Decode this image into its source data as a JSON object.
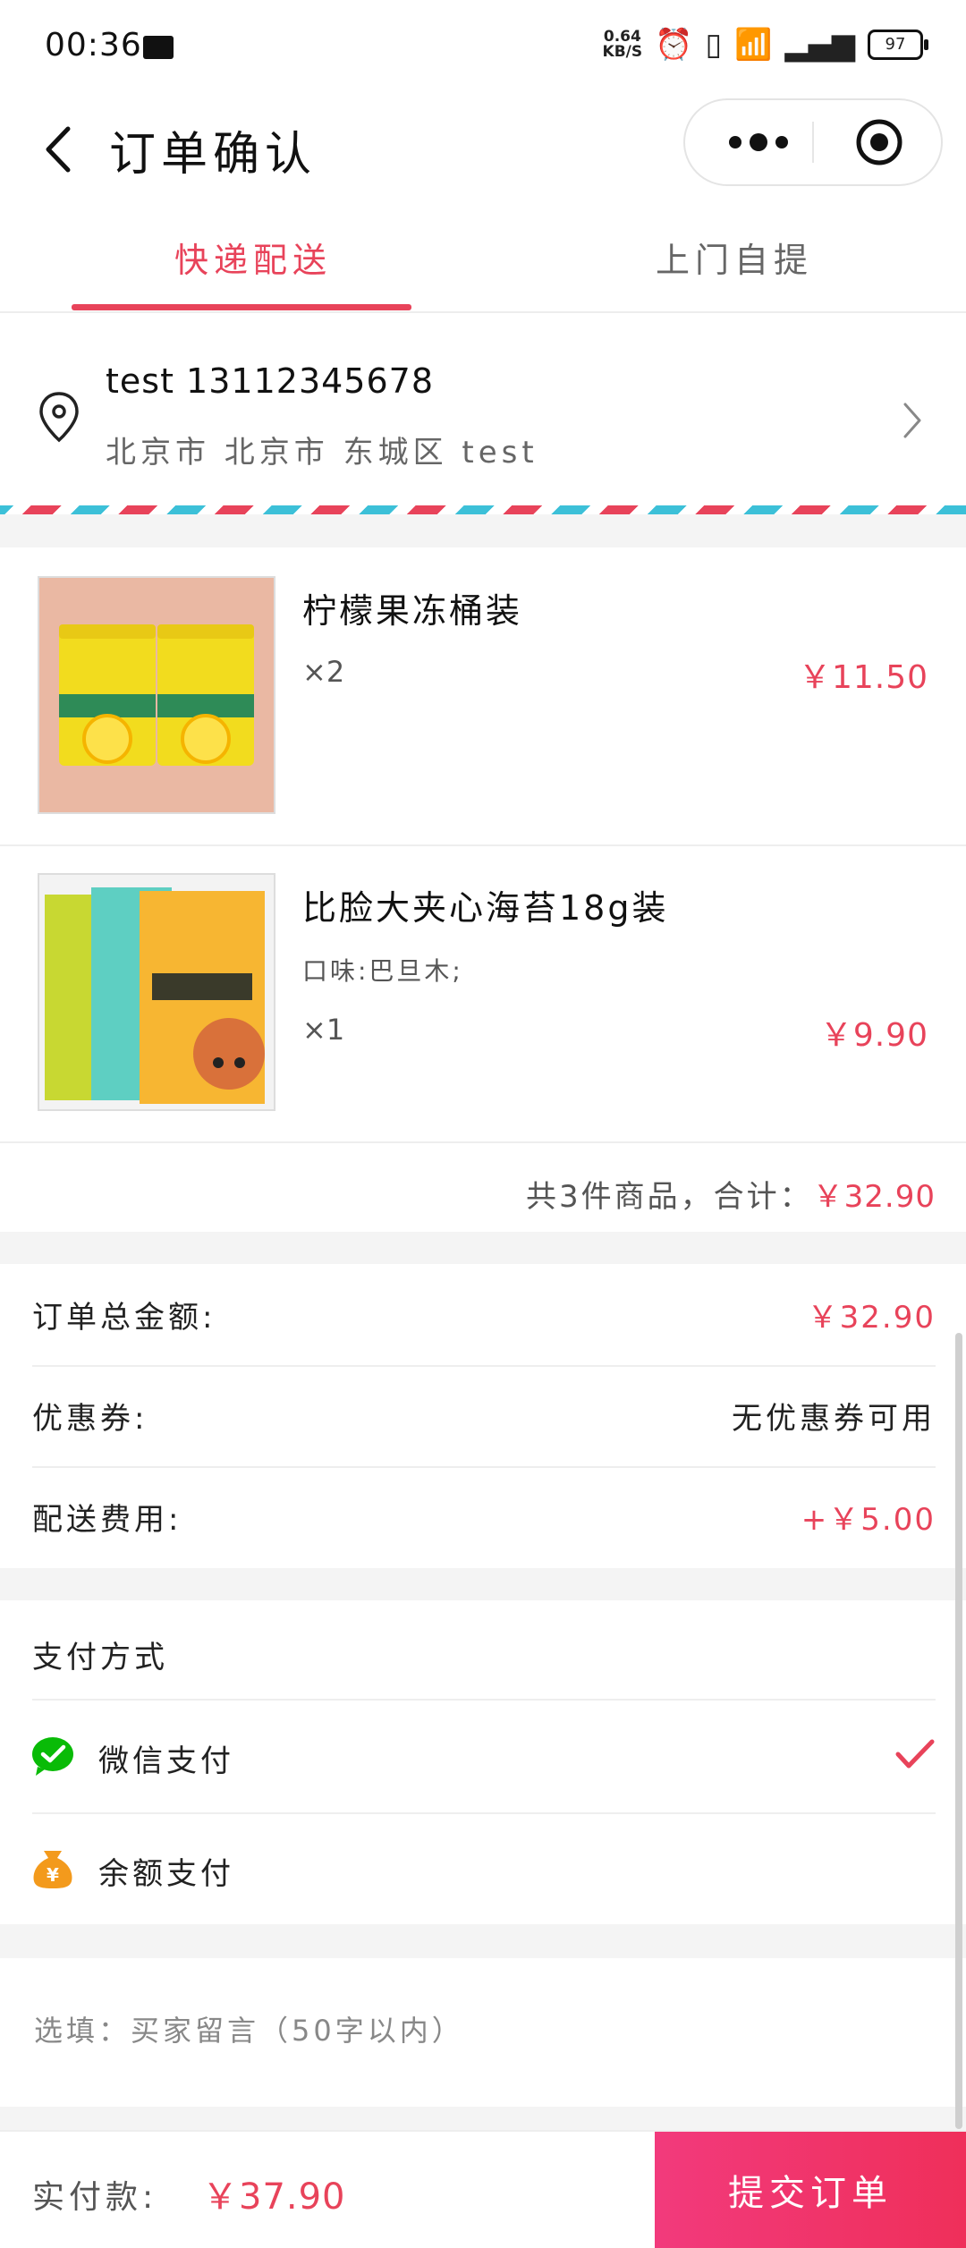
{
  "status_bar": {
    "time": "00:36",
    "net_speed_value": "0.64",
    "net_speed_unit": "KB/S",
    "battery": "97"
  },
  "navbar": {
    "title": "订单确认",
    "back_icon": "chevron-left-icon",
    "more_icon": "more-dots-icon",
    "close_icon": "target-circle-icon"
  },
  "tabs": [
    {
      "label": "快递配送",
      "active": true
    },
    {
      "label": "上门自提",
      "active": false
    }
  ],
  "address": {
    "name_phone": "test 13112345678",
    "detail": "北京市 北京市 东城区 test",
    "icon": "location-pin-icon"
  },
  "goods": [
    {
      "name": "柠檬果冻桶装",
      "spec": "",
      "qty": "×2",
      "price": "￥11.50"
    },
    {
      "name": "比脸大夹心海苔18g装",
      "spec": "口味:巴旦木;",
      "qty": "×1",
      "price": "￥9.90"
    }
  ],
  "goods_summary": {
    "text": "共3件商品，合计：",
    "amount": "￥32.90"
  },
  "amounts": {
    "order_total_label": "订单总金额:",
    "order_total_value": "￥32.90",
    "coupon_label": "优惠券:",
    "coupon_value": "无优惠券可用",
    "delivery_label": "配送费用:",
    "delivery_value": "+￥5.00"
  },
  "payment": {
    "title": "支付方式",
    "methods": [
      {
        "label": "微信支付",
        "icon": "wechat-pay-icon",
        "selected": true
      },
      {
        "label": "余额支付",
        "icon": "money-bag-icon",
        "selected": false
      }
    ]
  },
  "remark": {
    "placeholder": "选填：买家留言（50字以内）"
  },
  "bottom": {
    "pay_label": "实付款:",
    "pay_amount": "￥37.90",
    "submit_label": "提交订单"
  },
  "colors": {
    "accent": "#e8435a",
    "wechat_green": "#09bb07",
    "balance_orange": "#f39a1c"
  }
}
